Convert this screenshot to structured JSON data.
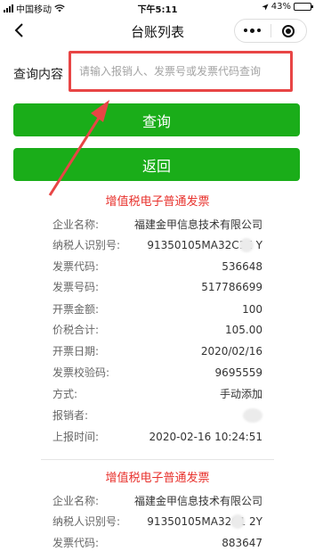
{
  "status_bar": {
    "carrier": "中国移动",
    "time": "下午5:11",
    "battery": "43%",
    "battery_level": 0.43
  },
  "nav": {
    "title": "台账列表"
  },
  "query": {
    "label": "查询内容",
    "placeholder": "请输入报销人、发票号或发票代码查询"
  },
  "buttons": {
    "query": "查询",
    "back": "返回"
  },
  "invoices": [
    {
      "title": "增值税电子普通发票",
      "fields": [
        {
          "label": "企业名称:",
          "value": "福建金甲信息技术有限公司"
        },
        {
          "label": "纳税人识别号:",
          "value": "91350105MA32C1E  Y"
        },
        {
          "label": "发票代码:",
          "value": "536648"
        },
        {
          "label": "发票号码:",
          "value": "517786699"
        },
        {
          "label": "开票金额:",
          "value": "100"
        },
        {
          "label": "价税合计:",
          "value": "105.00"
        },
        {
          "label": "开票日期:",
          "value": "2020/02/16"
        },
        {
          "label": "发票校验码:",
          "value": "9695559"
        },
        {
          "label": "方式:",
          "value": "手动添加"
        },
        {
          "label": "报销者:",
          "value": ""
        },
        {
          "label": "上报时间:",
          "value": "2020-02-16 10:24:51"
        }
      ]
    },
    {
      "title": "增值税电子普通发票",
      "fields": [
        {
          "label": "企业名称:",
          "value": "福建金甲信息技术有限公司"
        },
        {
          "label": "纳税人识别号:",
          "value": "91350105MA32C1  2Y"
        },
        {
          "label": "发票代码:",
          "value": "883647"
        }
      ]
    }
  ]
}
